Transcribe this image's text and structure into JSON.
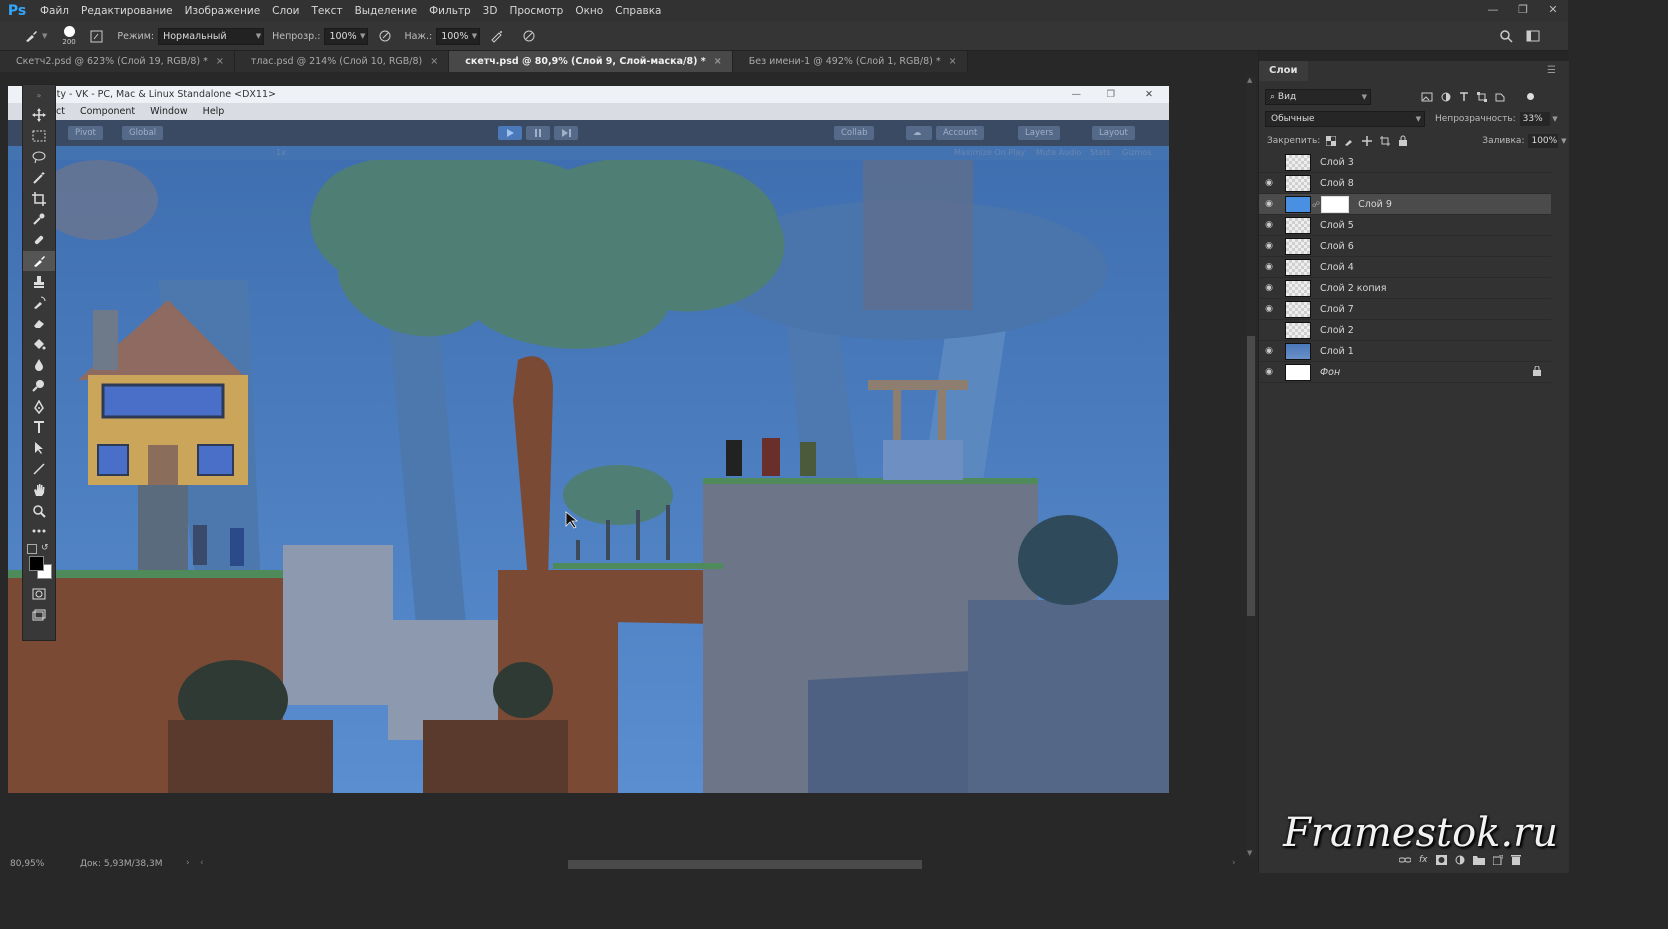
{
  "app": {
    "logo": "Ps"
  },
  "menu": [
    "Файл",
    "Редактирование",
    "Изображение",
    "Слои",
    "Текст",
    "Выделение",
    "Фильтр",
    "3D",
    "Просмотр",
    "Окно",
    "Справка"
  ],
  "options": {
    "brush_size": "200",
    "mode_label": "Режим:",
    "mode_value": "Нормальный",
    "opacity_label": "Непрозр.:",
    "opacity_value": "100%",
    "pressure_label": "Наж.:",
    "pressure_value": "100%"
  },
  "tabs": [
    {
      "label": "Скетч2.psd @ 623% (Слой 19, RGB/8) *",
      "active": false
    },
    {
      "label": "тлас.psd @ 214% (Слой 10, RGB/8)",
      "active": false
    },
    {
      "label": "скетч.psd @ 80,9% (Слой 9, Слой-маска/8) *",
      "active": true
    },
    {
      "label": "Без имени-1 @ 492% (Слой 1, RGB/8) *",
      "active": false
    }
  ],
  "tools": [
    "move-icon",
    "marquee-icon",
    "lasso-icon",
    "magic-wand-icon",
    "crop-icon",
    "eyedropper-icon",
    "healing-icon",
    "brush-icon",
    "stamp-icon",
    "history-brush-icon",
    "eraser-icon",
    "paint-bucket-icon",
    "blur-icon",
    "dodge-icon",
    "pen-icon",
    "type-icon",
    "path-select-icon",
    "line-icon",
    "hand-icon",
    "zoom-icon",
    "more-icon"
  ],
  "unity": {
    "title": "ity - VK - PC, Mac & Linux Standalone <DX11>",
    "menu": [
      "ct",
      "Component",
      "Window",
      "Help"
    ],
    "pivot": "Pivot",
    "global": "Global",
    "collab": "Collab",
    "account": "Account",
    "layers": "Layers",
    "layout": "Layout",
    "game_scale_value": "1x",
    "game_options": [
      "Maximize On Play",
      "Mute Audio",
      "Stats",
      "Gizmos"
    ]
  },
  "status": {
    "zoom": "80,95%",
    "doc": "Док: 5,93M/38,3M"
  },
  "layers_panel": {
    "tab": "Слои",
    "filter": "Вид",
    "blend": "Обычные",
    "opacity_label": "Непрозрачность:",
    "opacity_value": "33%",
    "lock_label": "Закрепить:",
    "fill_label": "Заливка:",
    "fill_value": "100%",
    "layers": [
      {
        "name": "Слой 3",
        "visible": false,
        "selected": false
      },
      {
        "name": "Слой 8",
        "visible": true,
        "selected": false
      },
      {
        "name": "Слой 9",
        "visible": true,
        "selected": true
      },
      {
        "name": "Слой 5",
        "visible": true,
        "selected": false
      },
      {
        "name": "Слой 6",
        "visible": true,
        "selected": false
      },
      {
        "name": "Слой 4",
        "visible": true,
        "selected": false
      },
      {
        "name": "Слой 2 копия",
        "visible": true,
        "selected": false
      },
      {
        "name": "Слой 7",
        "visible": true,
        "selected": false
      },
      {
        "name": "Слой 2",
        "visible": false,
        "selected": false
      },
      {
        "name": "Слой 1",
        "visible": true,
        "selected": false
      },
      {
        "name": "Фон",
        "visible": true,
        "selected": false
      }
    ]
  },
  "watermark": "Framestok.ru",
  "colors": {
    "accent": "#31a8ff",
    "sky": "#4473b2",
    "ground": "#7a4a35"
  }
}
